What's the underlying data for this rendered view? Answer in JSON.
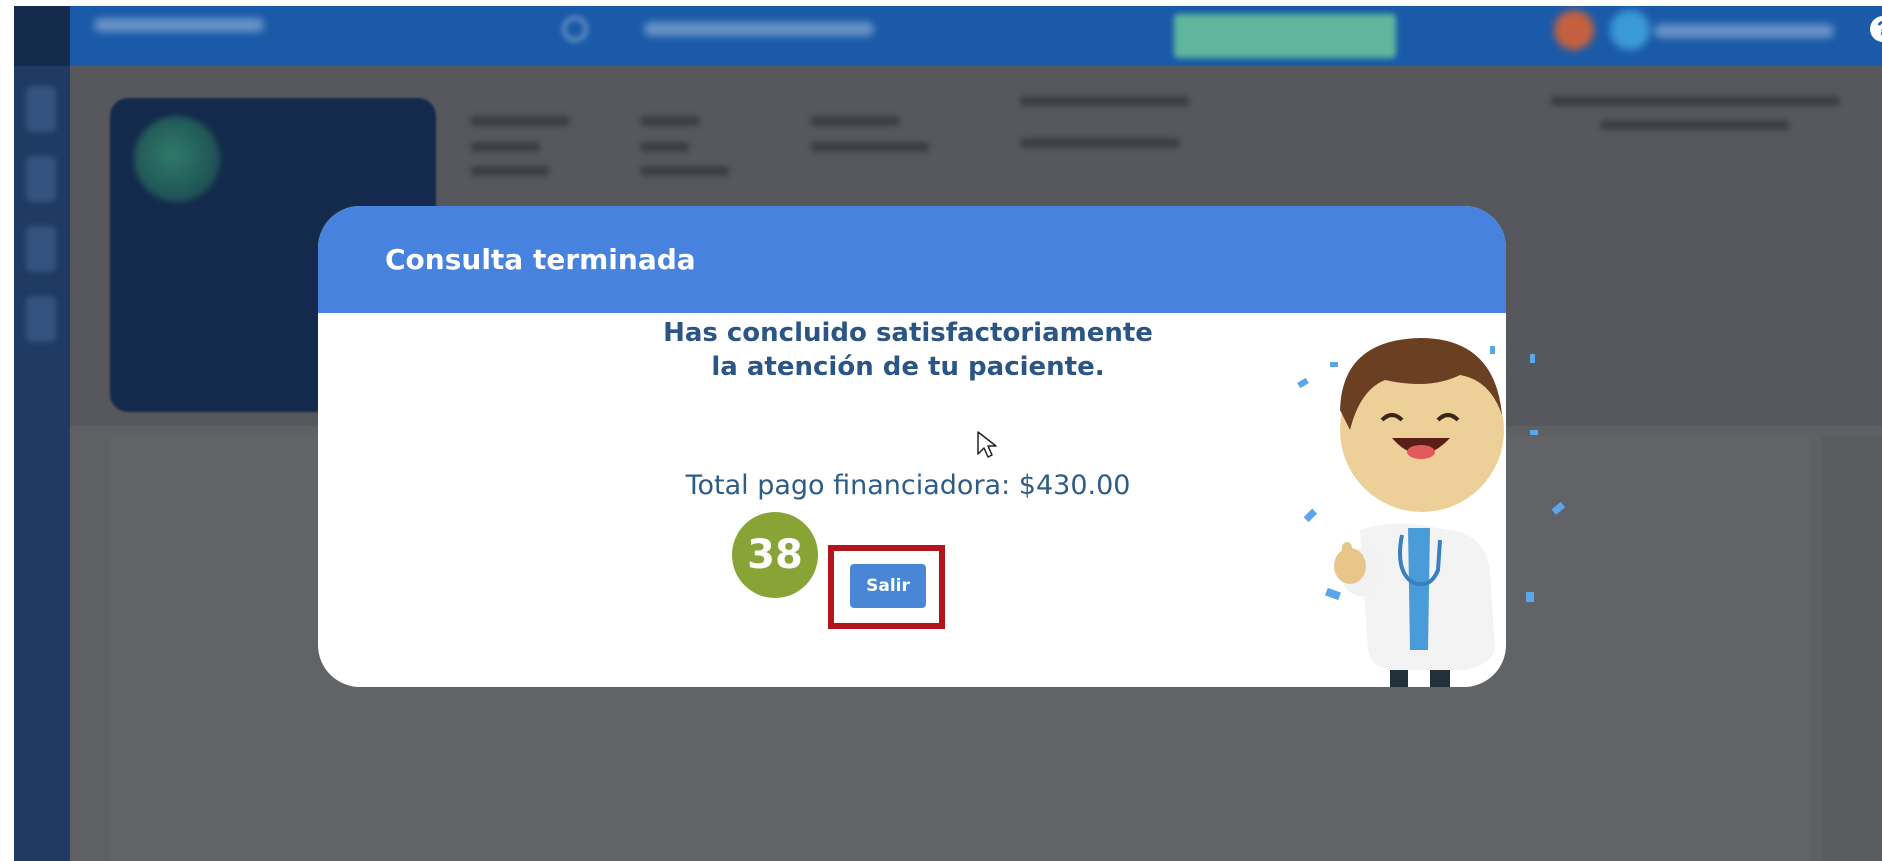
{
  "app": {
    "help_icon": "?",
    "icons": [
      "search-icon",
      "help-icon"
    ],
    "colors": {
      "topbar": "#1a5aa8",
      "sidebar": "#1f3a63",
      "overlay": "#5f6063"
    }
  },
  "modal": {
    "title": "Consulta terminada",
    "message_line1": "Has concluido satisfactoriamente",
    "message_line2": "la atención de tu paciente.",
    "total_text": "Total pago financiadora: $430.00",
    "exit_button_label": "Salir",
    "colors": {
      "header": "#4782df",
      "text": "#2a5584",
      "button": "#4a86d6"
    }
  },
  "annotation": {
    "step_number": "38",
    "colors": {
      "badge": "#88a336",
      "highlight": "#b4141c"
    }
  }
}
